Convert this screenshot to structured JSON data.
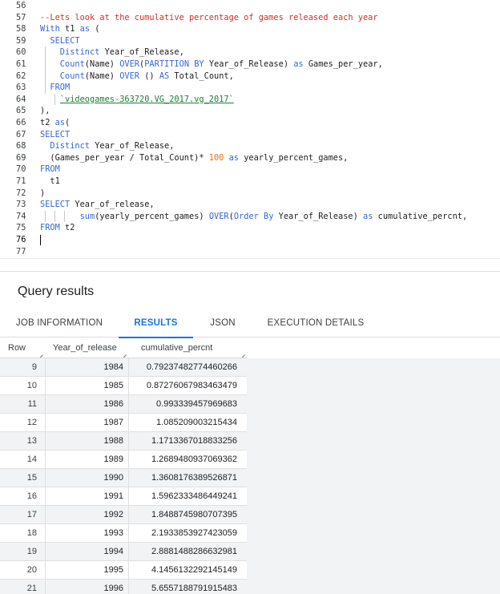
{
  "editor": {
    "lines": [
      {
        "n": "56",
        "tokens": []
      },
      {
        "n": "57",
        "tokens": [
          {
            "t": "--Lets look at the cumulative percentage of games released each year",
            "c": "cm"
          }
        ]
      },
      {
        "n": "58",
        "tokens": [
          {
            "t": "With",
            "c": "kw"
          },
          {
            "t": " t1 ",
            "c": ""
          },
          {
            "t": "as",
            "c": "kw"
          },
          {
            "t": " (",
            "c": ""
          }
        ]
      },
      {
        "n": "59",
        "tokens": [
          {
            "t": "  SELECT",
            "c": "kw"
          }
        ]
      },
      {
        "n": "60",
        "tokens": [
          {
            "t": "    Distinct",
            "c": "kw"
          },
          {
            "t": " Year_of_Release,",
            "c": ""
          }
        ]
      },
      {
        "n": "61",
        "tokens": [
          {
            "t": "    Count",
            "c": "kw"
          },
          {
            "t": "(Name) ",
            "c": ""
          },
          {
            "t": "OVER",
            "c": "kw"
          },
          {
            "t": "(",
            "c": ""
          },
          {
            "t": "PARTITION BY",
            "c": "kw"
          },
          {
            "t": " Year_of_Release) ",
            "c": ""
          },
          {
            "t": "as",
            "c": "kw"
          },
          {
            "t": " Games_per_year,",
            "c": ""
          }
        ]
      },
      {
        "n": "62",
        "tokens": [
          {
            "t": "    Count",
            "c": "kw"
          },
          {
            "t": "(Name) ",
            "c": ""
          },
          {
            "t": "OVER",
            "c": "kw"
          },
          {
            "t": " () ",
            "c": ""
          },
          {
            "t": "AS",
            "c": "kw"
          },
          {
            "t": " Total_Count,",
            "c": ""
          }
        ]
      },
      {
        "n": "63",
        "tokens": [
          {
            "t": "  FROM",
            "c": "kw"
          }
        ]
      },
      {
        "n": "64",
        "tokens": [
          {
            "t": "    ",
            "c": ""
          },
          {
            "t": "`videogames-363720.VG_2017.vg_2017`",
            "c": "str"
          }
        ]
      },
      {
        "n": "65",
        "tokens": [
          {
            "t": "),",
            "c": ""
          }
        ]
      },
      {
        "n": "66",
        "tokens": [
          {
            "t": "t2 ",
            "c": ""
          },
          {
            "t": "as",
            "c": "kw"
          },
          {
            "t": "(",
            "c": ""
          }
        ]
      },
      {
        "n": "67",
        "tokens": [
          {
            "t": "SELECT",
            "c": "kw"
          }
        ]
      },
      {
        "n": "68",
        "tokens": [
          {
            "t": "  Distinct",
            "c": "kw"
          },
          {
            "t": " Year_of_Release,",
            "c": ""
          }
        ]
      },
      {
        "n": "69",
        "tokens": [
          {
            "t": "  (Games_per_year / Total_Count)* ",
            "c": ""
          },
          {
            "t": "100",
            "c": "num"
          },
          {
            "t": " ",
            "c": ""
          },
          {
            "t": "as",
            "c": "kw"
          },
          {
            "t": " yearly_percent_games,",
            "c": ""
          }
        ]
      },
      {
        "n": "70",
        "tokens": [
          {
            "t": "FROM",
            "c": "kw"
          }
        ]
      },
      {
        "n": "71",
        "tokens": [
          {
            "t": "  t1",
            "c": ""
          }
        ]
      },
      {
        "n": "72",
        "tokens": [
          {
            "t": ")",
            "c": ""
          }
        ]
      },
      {
        "n": "73",
        "tokens": [
          {
            "t": "SELECT",
            "c": "kw"
          },
          {
            "t": " Year_of_release,",
            "c": ""
          }
        ]
      },
      {
        "n": "74",
        "tokens": [
          {
            "t": "        ",
            "c": ""
          },
          {
            "t": "sum",
            "c": "kw"
          },
          {
            "t": "(yearly_percent_games) ",
            "c": ""
          },
          {
            "t": "OVER",
            "c": "kw"
          },
          {
            "t": "(",
            "c": ""
          },
          {
            "t": "Order By",
            "c": "kw"
          },
          {
            "t": " Year_of_Release) ",
            "c": ""
          },
          {
            "t": "as",
            "c": "kw"
          },
          {
            "t": " cumulative_percnt,",
            "c": ""
          }
        ]
      },
      {
        "n": "75",
        "tokens": [
          {
            "t": "FROM",
            "c": "kw"
          },
          {
            "t": " t2",
            "c": ""
          }
        ]
      },
      {
        "n": "76",
        "tokens": [],
        "cursor": true,
        "active": true
      },
      {
        "n": "77",
        "tokens": []
      }
    ]
  },
  "results": {
    "title": "Query results",
    "tabs": [
      {
        "label": "JOB INFORMATION",
        "active": false
      },
      {
        "label": "RESULTS",
        "active": true
      },
      {
        "label": "JSON",
        "active": false
      },
      {
        "label": "EXECUTION DETAILS",
        "active": false
      }
    ],
    "columns": [
      "Row",
      "Year_of_release",
      "cumulative_percnt"
    ],
    "rows": [
      [
        "9",
        "1984",
        "0.79237482774460266"
      ],
      [
        "10",
        "1985",
        "0.87276067983463479"
      ],
      [
        "11",
        "1986",
        "0.993339457969683"
      ],
      [
        "12",
        "1987",
        "1.085209003215434"
      ],
      [
        "13",
        "1988",
        "1.1713367018833256"
      ],
      [
        "14",
        "1989",
        "1.2689480937069362"
      ],
      [
        "15",
        "1990",
        "1.3608176389526871"
      ],
      [
        "16",
        "1991",
        "1.5962333486449241"
      ],
      [
        "17",
        "1992",
        "1.8488745980707395"
      ],
      [
        "18",
        "1993",
        "2.1933853927423059"
      ],
      [
        "19",
        "1994",
        "2.8881488286632981"
      ],
      [
        "20",
        "1995",
        "4.1456132292145149"
      ],
      [
        "21",
        "1996",
        "5.6557188791915483"
      ]
    ]
  }
}
